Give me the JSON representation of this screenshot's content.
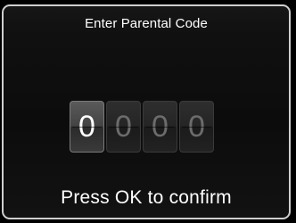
{
  "dialog": {
    "title": "Enter Parental Code",
    "digits": [
      {
        "value": "0",
        "active": true
      },
      {
        "value": "0",
        "active": false
      },
      {
        "value": "0",
        "active": false
      },
      {
        "value": "0",
        "active": false
      }
    ],
    "hint": "Press OK to confirm"
  }
}
